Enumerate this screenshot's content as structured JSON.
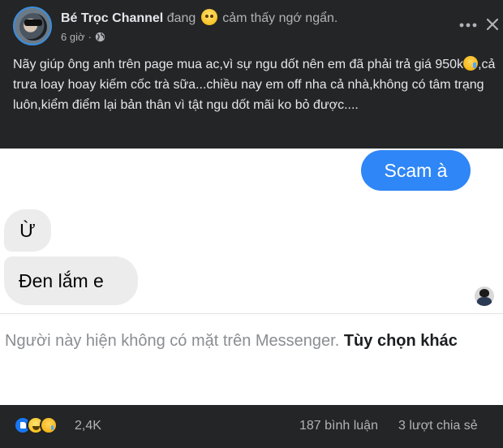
{
  "post": {
    "author": "Bé Trọc Channel",
    "feeling_verb": "đang",
    "feeling_text": "cảm thấy ngớ ngẩn.",
    "time": "6 giờ",
    "separator": "·",
    "caption_part1": "Nãy giúp ông anh trên page mua ac,vì sự ngu dốt nên em đã phải trả giá 950k",
    "caption_part2": ",cả trưa loay hoay kiếm cốc trà sữa...chiều nay em off nha cả nhà,không có tâm trạng luôn,kiểm điểm lại bản thân vì tật ngu dốt mãi ko bỏ được...."
  },
  "image": {
    "sent_message": "Scam à",
    "received_1": "Ừ",
    "received_2": "Đen lắm e",
    "unavailable_text": "Người này hiện không có mặt trên Messenger.",
    "other_options": "Tùy chọn khác"
  },
  "footer": {
    "reaction_count": "2,4K",
    "comments": "187 bình luận",
    "shares": "3 lượt chia sẻ"
  },
  "icons": {
    "feeling": "thinking-face-emoji",
    "privacy": "globe-icon",
    "more": "more-dots-icon",
    "close": "close-icon",
    "reactions": [
      "like-icon",
      "haha-icon",
      "sad-icon"
    ]
  },
  "colors": {
    "background": "#242526",
    "text": "#e4e6eb",
    "muted": "#b0b3b8",
    "messenger_blue": "#2f86f6",
    "like_blue": "#1877f2"
  }
}
